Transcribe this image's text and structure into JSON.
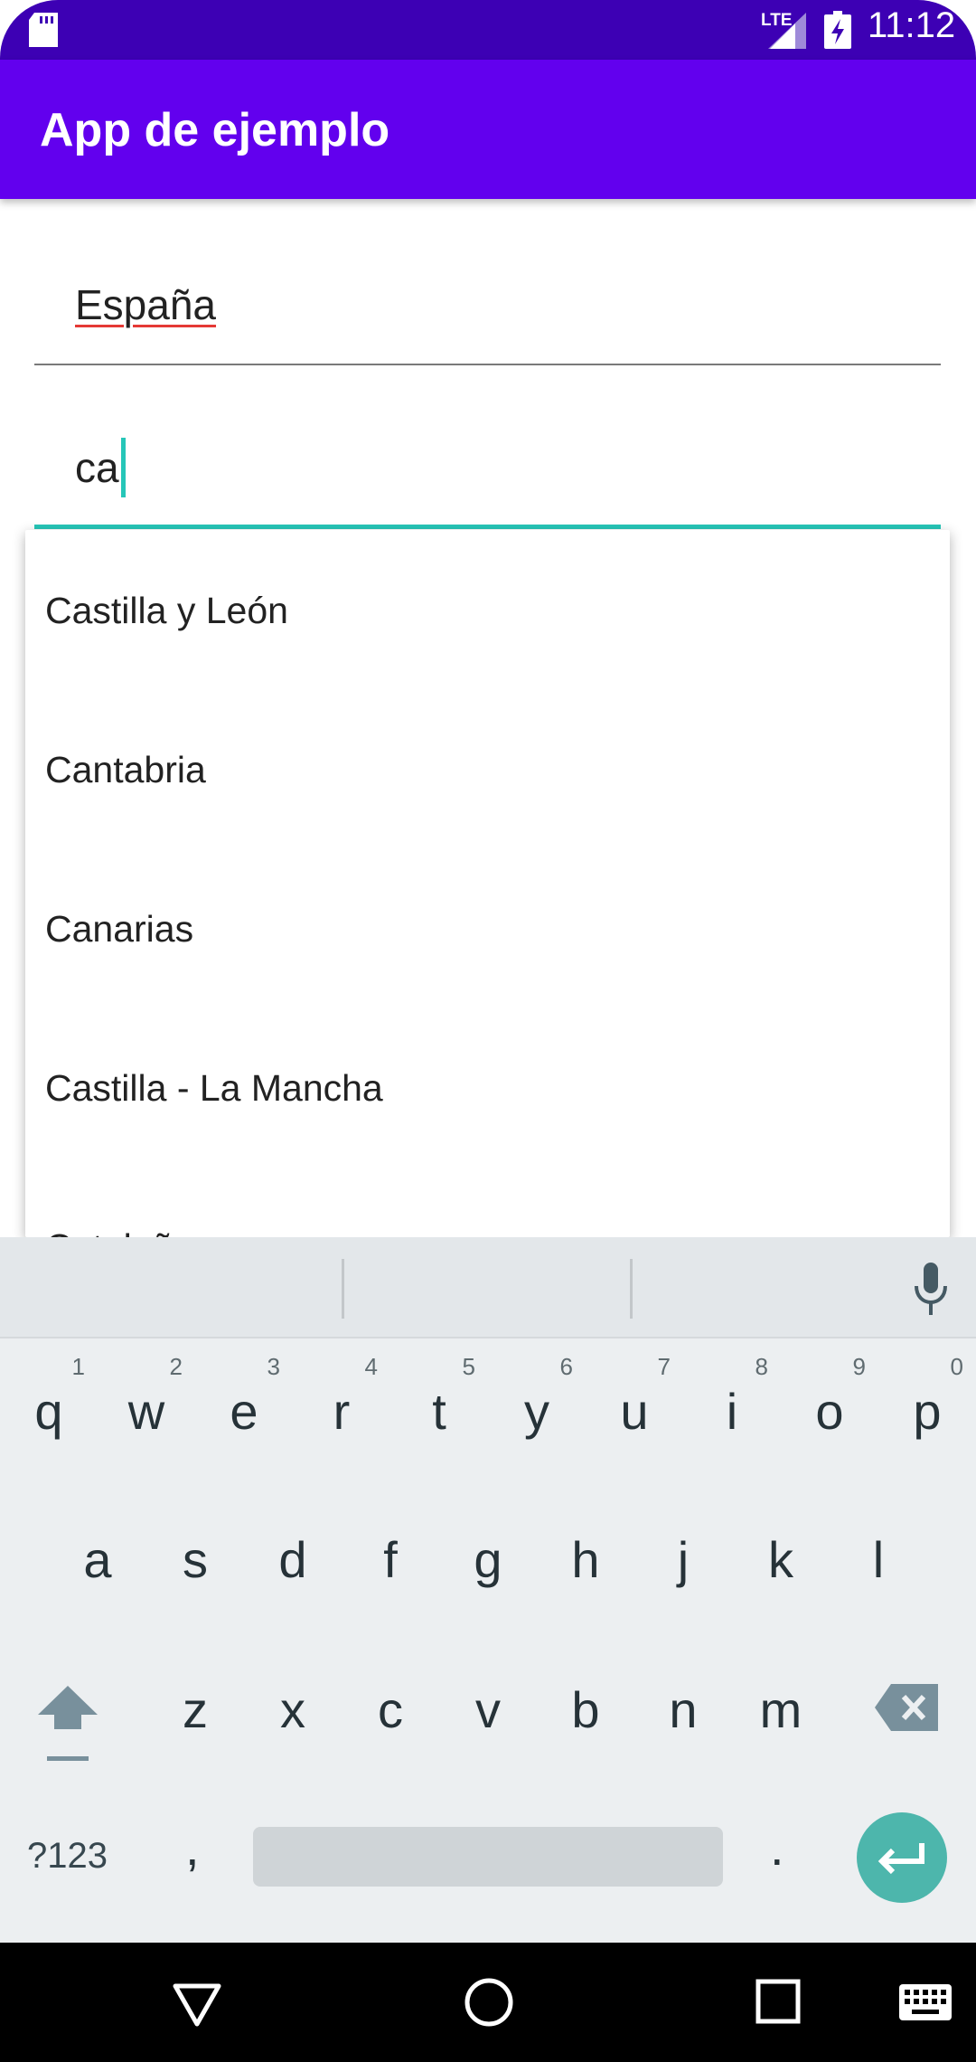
{
  "status_bar": {
    "network": "LTE",
    "time": "11:12",
    "icons": [
      "sd-card-icon",
      "signal-icon",
      "battery-charging-icon"
    ]
  },
  "app_bar": {
    "title": "App de ejemplo"
  },
  "fields": {
    "country_value": "España",
    "region_value": "ca"
  },
  "suggestions": [
    "Castilla y León",
    "Cantabria",
    "Canarias",
    "Castilla - La Mancha",
    "Cataluña"
  ],
  "keyboard": {
    "row1": [
      {
        "key": "q",
        "hint": "1"
      },
      {
        "key": "w",
        "hint": "2"
      },
      {
        "key": "e",
        "hint": "3"
      },
      {
        "key": "r",
        "hint": "4"
      },
      {
        "key": "t",
        "hint": "5"
      },
      {
        "key": "y",
        "hint": "6"
      },
      {
        "key": "u",
        "hint": "7"
      },
      {
        "key": "i",
        "hint": "8"
      },
      {
        "key": "o",
        "hint": "9"
      },
      {
        "key": "p",
        "hint": "0"
      }
    ],
    "row2": [
      "a",
      "s",
      "d",
      "f",
      "g",
      "h",
      "j",
      "k",
      "l"
    ],
    "row3": [
      "z",
      "x",
      "c",
      "v",
      "b",
      "n",
      "m"
    ],
    "symbols_label": "?123",
    "comma": ",",
    "period": ".",
    "accent_color": "#4db6ac"
  },
  "colors": {
    "status_bar": "#3d00b4",
    "app_bar": "#6200ee",
    "focus": "#26c6b8"
  }
}
